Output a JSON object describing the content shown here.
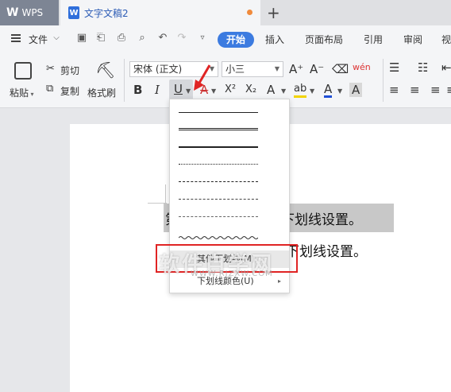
{
  "tabs": {
    "app": "WPS",
    "document": "文字文稿2",
    "add": "+"
  },
  "menu": {
    "file": "文件",
    "start": "开始",
    "insert": "插入",
    "layout": "页面布局",
    "reference": "引用",
    "review": "审阅",
    "view": "视"
  },
  "ribbon": {
    "paste": "粘贴",
    "cut": "剪切",
    "copy": "复制",
    "format_painter": "格式刷",
    "font_name": "宋体 (正文)",
    "font_size": "小三",
    "bold": "B",
    "italic": "I",
    "underline": "U",
    "strike": "A",
    "superscript": "X²",
    "subscript": "X₂",
    "grow_font": "A⁺",
    "shrink_font": "A⁻",
    "text_effect": "A",
    "highlight": "ab",
    "font_color": "A",
    "char_shade": "A",
    "pinyin": "wén"
  },
  "document": {
    "line1_prefix": "第",
    "line1_suffix": "下划线设置。",
    "line2_suffix": "下划线设置。"
  },
  "dropdown": {
    "other_underline": "其他下划线(M)...",
    "underline_color": "下划线颜色(U)"
  },
  "watermark": {
    "main": "软件自学网",
    "sub": "WWW.RJZXW.COM"
  },
  "colors": {
    "accent": "#3c7be0",
    "highlight_box": "#e02424",
    "font_color_bar": "#1f4fd6",
    "highlight_bar": "#f2d400"
  }
}
